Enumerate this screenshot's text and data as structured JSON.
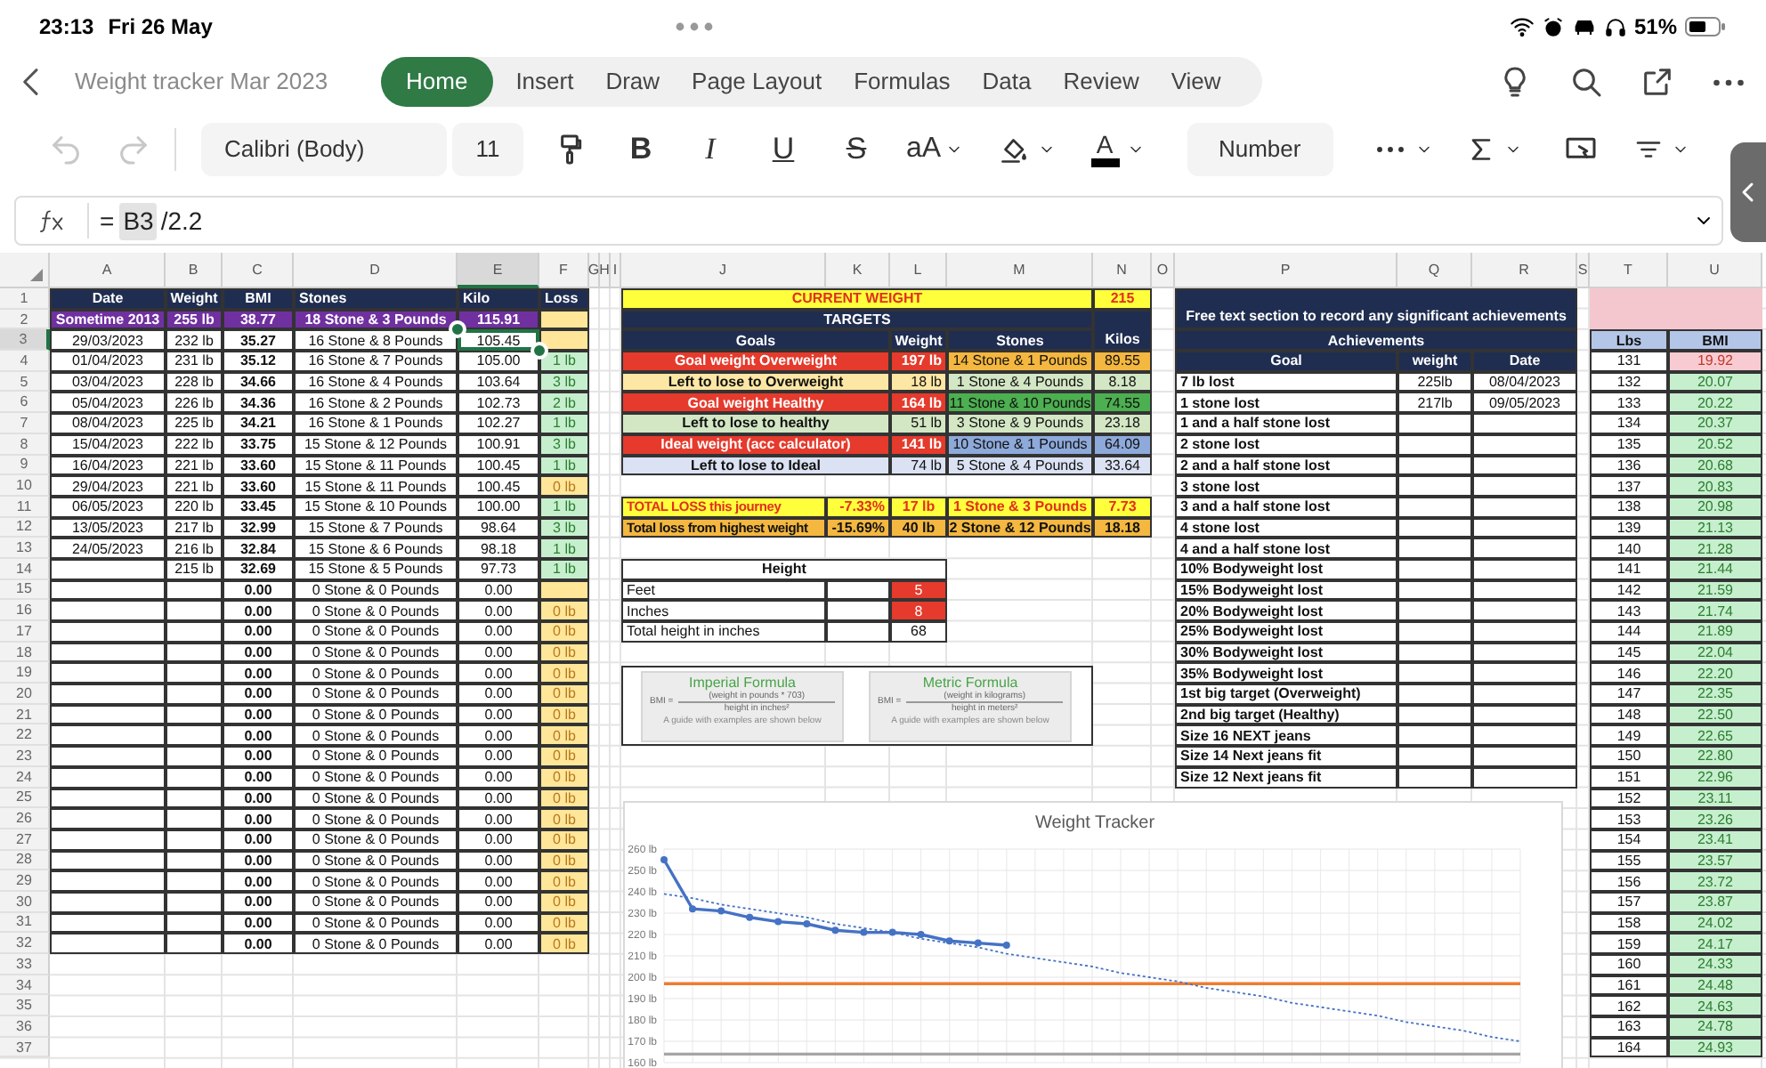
{
  "status_bar": {
    "time": "23:13",
    "date": "Fri 26 May",
    "battery": "51%"
  },
  "document": {
    "title": "Weight tracker Mar 2023"
  },
  "tabs": [
    {
      "label": "Home",
      "selected": true
    },
    {
      "label": "Insert",
      "selected": false
    },
    {
      "label": "Draw",
      "selected": false
    },
    {
      "label": "Page Layout",
      "selected": false
    },
    {
      "label": "Formulas",
      "selected": false
    },
    {
      "label": "Data",
      "selected": false
    },
    {
      "label": "Review",
      "selected": false
    },
    {
      "label": "View",
      "selected": false
    }
  ],
  "toolbar": {
    "font": "Calibri (Body)",
    "font_size": "11",
    "bold": "B",
    "italic": "I",
    "underline": "U",
    "strikethrough": "S",
    "text_size": "aA",
    "font_color": "A",
    "number_format": "Number"
  },
  "formula_bar": {
    "prefix": "=",
    "reference": "B3",
    "rest": "/2.2"
  },
  "columns": [
    {
      "label": "A",
      "selected": false
    },
    {
      "label": "B",
      "selected": false
    },
    {
      "label": "C",
      "selected": false
    },
    {
      "label": "D",
      "selected": false
    },
    {
      "label": "E",
      "selected": true
    },
    {
      "label": "F",
      "selected": false
    },
    {
      "label": "G",
      "selected": false
    },
    {
      "label": "H",
      "selected": false
    },
    {
      "label": "I",
      "selected": false
    },
    {
      "label": "J",
      "selected": false
    },
    {
      "label": "K",
      "selected": false
    },
    {
      "label": "L",
      "selected": false
    },
    {
      "label": "M",
      "selected": false
    },
    {
      "label": "N",
      "selected": false
    },
    {
      "label": "O",
      "selected": false
    },
    {
      "label": "P",
      "selected": false
    },
    {
      "label": "Q",
      "selected": false
    },
    {
      "label": "R",
      "selected": false
    },
    {
      "label": "S",
      "selected": false
    },
    {
      "label": "T",
      "selected": false
    },
    {
      "label": "U",
      "selected": false
    }
  ],
  "rows": [
    {
      "label": "1",
      "selected": false
    },
    {
      "label": "2",
      "selected": false
    },
    {
      "label": "3",
      "selected": true
    },
    {
      "label": "4",
      "selected": false
    },
    {
      "label": "5",
      "selected": false
    },
    {
      "label": "6",
      "selected": false
    },
    {
      "label": "7",
      "selected": false
    },
    {
      "label": "8",
      "selected": false
    },
    {
      "label": "9",
      "selected": false
    },
    {
      "label": "10",
      "selected": false
    },
    {
      "label": "11",
      "selected": false
    },
    {
      "label": "12",
      "selected": false
    },
    {
      "label": "13",
      "selected": false
    },
    {
      "label": "14",
      "selected": false
    },
    {
      "label": "15",
      "selected": false
    },
    {
      "label": "16",
      "selected": false
    },
    {
      "label": "17",
      "selected": false
    },
    {
      "label": "18",
      "selected": false
    },
    {
      "label": "19",
      "selected": false
    },
    {
      "label": "20",
      "selected": false
    },
    {
      "label": "21",
      "selected": false
    },
    {
      "label": "22",
      "selected": false
    },
    {
      "label": "23",
      "selected": false
    },
    {
      "label": "24",
      "selected": false
    },
    {
      "label": "25",
      "selected": false
    },
    {
      "label": "26",
      "selected": false
    },
    {
      "label": "27",
      "selected": false
    },
    {
      "label": "28",
      "selected": false
    },
    {
      "label": "29",
      "selected": false
    },
    {
      "label": "30",
      "selected": false
    },
    {
      "label": "31",
      "selected": false
    },
    {
      "label": "32",
      "selected": false
    },
    {
      "label": "33",
      "selected": false
    },
    {
      "label": "34",
      "selected": false
    },
    {
      "label": "35",
      "selected": false
    },
    {
      "label": "36",
      "selected": false
    },
    {
      "label": "37",
      "selected": false
    }
  ],
  "log": {
    "columns": [
      "Date",
      "Weight",
      "BMI",
      "Stones",
      "Kilo",
      "Loss"
    ],
    "rows": [
      {
        "kind": "start",
        "date": "Sometime 2013",
        "weight": "255 lb",
        "bmi": "38.77",
        "stones": "18 Stone & 3 Pounds",
        "kilo": "115.91",
        "loss": {
          "color": "#ffe699"
        }
      },
      {
        "kind": "entry",
        "date": "29/03/2023",
        "weight": "232 lb",
        "bmi": "35.27",
        "stones": "16 Stone & 8 Pounds",
        "kilo": "105.45",
        "loss": {
          "color": "#ffe699"
        }
      },
      {
        "kind": "entry",
        "date": "01/04/2023",
        "weight": "231 lb",
        "bmi": "35.12",
        "stones": "16 Stone & 7 Pounds",
        "kilo": "105.00",
        "loss": {
          "value": "1 lb",
          "color": "#c6efce"
        }
      },
      {
        "kind": "entry",
        "date": "03/04/2023",
        "weight": "228 lb",
        "bmi": "34.66",
        "stones": "16 Stone & 4 Pounds",
        "kilo": "103.64",
        "loss": {
          "value": "3 lb",
          "color": "#c6efce"
        }
      },
      {
        "kind": "entry",
        "date": "05/04/2023",
        "weight": "226 lb",
        "bmi": "34.36",
        "stones": "16 Stone & 2 Pounds",
        "kilo": "102.73",
        "loss": {
          "value": "2 lb",
          "color": "#c6efce"
        }
      },
      {
        "kind": "entry",
        "date": "08/04/2023",
        "weight": "225 lb",
        "bmi": "34.21",
        "stones": "16 Stone & 1 Pounds",
        "kilo": "102.27",
        "loss": {
          "value": "1 lb",
          "color": "#c6efce"
        }
      },
      {
        "kind": "entry",
        "date": "15/04/2023",
        "weight": "222 lb",
        "bmi": "33.75",
        "stones": "15 Stone & 12 Pounds",
        "kilo": "100.91",
        "loss": {
          "value": "3 lb",
          "color": "#c6efce"
        }
      },
      {
        "kind": "entry",
        "date": "16/04/2023",
        "weight": "221 lb",
        "bmi": "33.60",
        "stones": "15 Stone & 11 Pounds",
        "kilo": "100.45",
        "loss": {
          "value": "1 lb",
          "color": "#c6efce"
        }
      },
      {
        "kind": "entry",
        "date": "29/04/2023",
        "weight": "221 lb",
        "bmi": "33.60",
        "stones": "15 Stone & 11 Pounds",
        "kilo": "100.45",
        "loss": {
          "value": "0 lb",
          "color": "#ffe699"
        }
      },
      {
        "kind": "entry",
        "date": "06/05/2023",
        "weight": "220 lb",
        "bmi": "33.45",
        "stones": "15 Stone & 10 Pounds",
        "kilo": "100.00",
        "loss": {
          "value": "1 lb",
          "color": "#c6efce"
        }
      },
      {
        "kind": "entry",
        "date": "13/05/2023",
        "weight": "217 lb",
        "bmi": "32.99",
        "stones": "15 Stone & 7 Pounds",
        "kilo": "98.64",
        "loss": {
          "value": "3 lb",
          "color": "#c6efce"
        }
      },
      {
        "kind": "entry",
        "date": "24/05/2023",
        "weight": "216 lb",
        "bmi": "32.84",
        "stones": "15 Stone & 6 Pounds",
        "kilo": "98.18",
        "loss": {
          "value": "1 lb",
          "color": "#c6efce"
        }
      },
      {
        "kind": "entry",
        "weight": "215 lb",
        "bmi": "32.69",
        "stones": "15 Stone & 5 Pounds",
        "kilo": "97.73",
        "loss": {
          "value": "1 lb",
          "color": "#c6efce"
        }
      },
      {
        "kind": "entry",
        "bmi": "0.00",
        "stones": "0 Stone & 0 Pounds",
        "kilo": "0.00",
        "loss": {
          "color": "#ffe699"
        }
      },
      {
        "kind": "entry",
        "bmi": "0.00",
        "stones": "0 Stone & 0 Pounds",
        "kilo": "0.00",
        "loss": {
          "value": "0 lb",
          "color": "#ffe699"
        }
      },
      {
        "kind": "entry",
        "bmi": "0.00",
        "stones": "0 Stone & 0 Pounds",
        "kilo": "0.00",
        "loss": {
          "value": "0 lb",
          "color": "#ffe699"
        }
      },
      {
        "kind": "entry",
        "bmi": "0.00",
        "stones": "0 Stone & 0 Pounds",
        "kilo": "0.00",
        "loss": {
          "value": "0 lb",
          "color": "#ffe699"
        }
      },
      {
        "kind": "entry",
        "bmi": "0.00",
        "stones": "0 Stone & 0 Pounds",
        "kilo": "0.00",
        "loss": {
          "value": "0 lb",
          "color": "#ffe699"
        }
      },
      {
        "kind": "entry",
        "bmi": "0.00",
        "stones": "0 Stone & 0 Pounds",
        "kilo": "0.00",
        "loss": {
          "value": "0 lb",
          "color": "#ffe699"
        }
      },
      {
        "kind": "entry",
        "bmi": "0.00",
        "stones": "0 Stone & 0 Pounds",
        "kilo": "0.00",
        "loss": {
          "value": "0 lb",
          "color": "#ffe699"
        }
      },
      {
        "kind": "entry",
        "bmi": "0.00",
        "stones": "0 Stone & 0 Pounds",
        "kilo": "0.00",
        "loss": {
          "value": "0 lb",
          "color": "#ffe699"
        }
      },
      {
        "kind": "entry",
        "bmi": "0.00",
        "stones": "0 Stone & 0 Pounds",
        "kilo": "0.00",
        "loss": {
          "value": "0 lb",
          "color": "#ffe699"
        }
      },
      {
        "kind": "entry",
        "bmi": "0.00",
        "stones": "0 Stone & 0 Pounds",
        "kilo": "0.00",
        "loss": {
          "value": "0 lb",
          "color": "#ffe699"
        }
      },
      {
        "kind": "entry",
        "bmi": "0.00",
        "stones": "0 Stone & 0 Pounds",
        "kilo": "0.00",
        "loss": {
          "value": "0 lb",
          "color": "#ffe699"
        }
      },
      {
        "kind": "entry",
        "bmi": "0.00",
        "stones": "0 Stone & 0 Pounds",
        "kilo": "0.00",
        "loss": {
          "value": "0 lb",
          "color": "#ffe699"
        }
      },
      {
        "kind": "entry",
        "bmi": "0.00",
        "stones": "0 Stone & 0 Pounds",
        "kilo": "0.00",
        "loss": {
          "value": "0 lb",
          "color": "#ffe699"
        }
      },
      {
        "kind": "entry",
        "bmi": "0.00",
        "stones": "0 Stone & 0 Pounds",
        "kilo": "0.00",
        "loss": {
          "value": "0 lb",
          "color": "#ffe699"
        }
      },
      {
        "kind": "entry",
        "bmi": "0.00",
        "stones": "0 Stone & 0 Pounds",
        "kilo": "0.00",
        "loss": {
          "value": "0 lb",
          "color": "#ffe699"
        }
      },
      {
        "kind": "entry",
        "bmi": "0.00",
        "stones": "0 Stone & 0 Pounds",
        "kilo": "0.00",
        "loss": {
          "value": "0 lb",
          "color": "#ffe699"
        }
      },
      {
        "kind": "entry",
        "bmi": "0.00",
        "stones": "0 Stone & 0 Pounds",
        "kilo": "0.00",
        "loss": {
          "value": "0 lb",
          "color": "#ffe699"
        }
      },
      {
        "kind": "entry",
        "bmi": "0.00",
        "stones": "0 Stone & 0 Pounds",
        "kilo": "0.00",
        "loss": {
          "value": "0 lb",
          "color": "#ffe699"
        }
      }
    ]
  },
  "current_weight": {
    "label": "CURRENT WEIGHT",
    "value": "215"
  },
  "targets": {
    "title": "TARGETS",
    "columns": [
      "Goals",
      "Weight",
      "Stones",
      "Kilos"
    ],
    "rows": [
      {
        "kind": "goal",
        "label": "Goal weight Overweight",
        "weight": "197 lb",
        "color": "#e53a2c",
        "conversion": {
          "stones": "14 Stone & 1 Pounds",
          "kilos": "89.55",
          "color": "#f4b73f"
        }
      },
      {
        "kind": "left",
        "label": "Left to lose to Overweight",
        "weight": "18 lb",
        "color": "#fde7a4",
        "conversion": {
          "stones": "1 Stone & 4 Pounds",
          "kilos": "8.18",
          "color": "#d4e7c5"
        }
      },
      {
        "kind": "goal",
        "label": "Goal weight Healthy",
        "weight": "164 lb",
        "color": "#e53a2c",
        "conversion": {
          "stones": "11 Stone & 10 Pounds",
          "kilos": "74.55",
          "color": "#4caf50"
        }
      },
      {
        "kind": "left",
        "label": "Left to lose to healthy",
        "weight": "51 lb",
        "color": "#d4e7c5",
        "conversion": {
          "stones": "3 Stone & 9 Pounds",
          "kilos": "23.18",
          "color": "#d4e7c5"
        }
      },
      {
        "kind": "goal",
        "label": "Ideal weight (acc calculator)",
        "weight": "141 lb",
        "color": "#e53a2c",
        "conversion": {
          "stones": "10 Stone & 1 Pounds",
          "kilos": "64.09",
          "color": "#8eaadb"
        }
      },
      {
        "kind": "left",
        "label": "Left to lose to Ideal",
        "weight": "74 lb",
        "color": "#dbe2f3",
        "conversion": {
          "stones": "5 Stone & 4 Pounds",
          "kilos": "33.64",
          "color": "#dbe2f3"
        }
      }
    ]
  },
  "totals": [
    {
      "kind": "journey",
      "label": "TOTAL LOSS this journey",
      "percent": "-7.33%",
      "weight": "17 lb",
      "stones": "1 Stone & 3 Pounds",
      "kilos": "7.73",
      "color": "#ffff3b"
    },
    {
      "kind": "highest",
      "label": "Total loss from highest weight",
      "percent": "-15.69%",
      "weight": "40 lb",
      "stones": "2 Stone & 12 Pounds",
      "kilos": "18.18",
      "color": "#f4b73f"
    }
  ],
  "height": {
    "title": "Height",
    "rows": [
      {
        "kind": "input",
        "label": "Feet",
        "value": "5"
      },
      {
        "kind": "input",
        "label": "Inches",
        "value": "8"
      },
      {
        "kind": "calc",
        "label": "Total height in inches",
        "value": "68"
      }
    ]
  },
  "formulas": [
    {
      "title": "Imperial Formula",
      "lhs": "BMI =",
      "numerator": "(weight in pounds * 703)",
      "denominator": "height in inches²",
      "note": "A guide with examples are shown below"
    },
    {
      "title": "Metric Formula",
      "lhs": "BMI =",
      "numerator": "(weight in kilograms)",
      "denominator": "height in meters²",
      "note": "A guide with examples are shown below"
    }
  ],
  "achievements": {
    "caption": "Free text section to record any significant achievements",
    "title": "Achievements",
    "columns": [
      "Goal",
      "weight",
      "Date"
    ],
    "rows": [
      {
        "goal": "7 lb lost",
        "weight": "225lb",
        "date": "08/04/2023"
      },
      {
        "goal": "1 stone lost",
        "weight": "217lb",
        "date": "09/05/2023"
      },
      {
        "goal": "1 and a half stone lost"
      },
      {
        "goal": "2 stone lost"
      },
      {
        "goal": "2 and a half stone lost"
      },
      {
        "goal": "3 stone lost"
      },
      {
        "goal": "3 and a half stone lost"
      },
      {
        "goal": "4 stone lost"
      },
      {
        "goal": "4 and a half stone lost"
      },
      {
        "goal": "10% Bodyweight lost"
      },
      {
        "goal": "15% Bodyweight lost"
      },
      {
        "goal": "20% Bodyweight lost"
      },
      {
        "goal": "25% Bodyweight lost"
      },
      {
        "goal": "30% Bodyweight lost"
      },
      {
        "goal": "35% Bodyweight lost"
      },
      {
        "goal": "1st big target (Overweight)"
      },
      {
        "goal": "2nd big target (Healthy)"
      },
      {
        "goal": "Size 16 NEXT jeans"
      },
      {
        "goal": "Size 14 Next jeans fit"
      },
      {
        "goal": "Size 12 Next jeans fit"
      }
    ]
  },
  "bmi_table": {
    "columns": [
      "Lbs",
      "BMI"
    ],
    "rows": [
      {
        "lbs": "131",
        "bmi": "19.92",
        "color": "#f8cbd2"
      },
      {
        "lbs": "132",
        "bmi": "20.07",
        "color": "#c6efce"
      },
      {
        "lbs": "133",
        "bmi": "20.22",
        "color": "#c6efce"
      },
      {
        "lbs": "134",
        "bmi": "20.37",
        "color": "#c6efce"
      },
      {
        "lbs": "135",
        "bmi": "20.52",
        "color": "#c6efce"
      },
      {
        "lbs": "136",
        "bmi": "20.68",
        "color": "#c6efce"
      },
      {
        "lbs": "137",
        "bmi": "20.83",
        "color": "#c6efce"
      },
      {
        "lbs": "138",
        "bmi": "20.98",
        "color": "#c6efce"
      },
      {
        "lbs": "139",
        "bmi": "21.13",
        "color": "#c6efce"
      },
      {
        "lbs": "140",
        "bmi": "21.28",
        "color": "#c6efce"
      },
      {
        "lbs": "141",
        "bmi": "21.44",
        "color": "#c6efce"
      },
      {
        "lbs": "142",
        "bmi": "21.59",
        "color": "#c6efce"
      },
      {
        "lbs": "143",
        "bmi": "21.74",
        "color": "#c6efce"
      },
      {
        "lbs": "144",
        "bmi": "21.89",
        "color": "#c6efce"
      },
      {
        "lbs": "145",
        "bmi": "22.04",
        "color": "#c6efce"
      },
      {
        "lbs": "146",
        "bmi": "22.20",
        "color": "#c6efce"
      },
      {
        "lbs": "147",
        "bmi": "22.35",
        "color": "#c6efce"
      },
      {
        "lbs": "148",
        "bmi": "22.50",
        "color": "#c6efce"
      },
      {
        "lbs": "149",
        "bmi": "22.65",
        "color": "#c6efce"
      },
      {
        "lbs": "150",
        "bmi": "22.80",
        "color": "#c6efce"
      },
      {
        "lbs": "151",
        "bmi": "22.96",
        "color": "#c6efce"
      },
      {
        "lbs": "152",
        "bmi": "23.11",
        "color": "#c6efce"
      },
      {
        "lbs": "153",
        "bmi": "23.26",
        "color": "#c6efce"
      },
      {
        "lbs": "154",
        "bmi": "23.41",
        "color": "#c6efce"
      },
      {
        "lbs": "155",
        "bmi": "23.57",
        "color": "#c6efce"
      },
      {
        "lbs": "156",
        "bmi": "23.72",
        "color": "#c6efce"
      },
      {
        "lbs": "157",
        "bmi": "23.87",
        "color": "#c6efce"
      },
      {
        "lbs": "158",
        "bmi": "24.02",
        "color": "#c6efce"
      },
      {
        "lbs": "159",
        "bmi": "24.17",
        "color": "#c6efce"
      },
      {
        "lbs": "160",
        "bmi": "24.33",
        "color": "#c6efce"
      },
      {
        "lbs": "161",
        "bmi": "24.48",
        "color": "#c6efce"
      },
      {
        "lbs": "162",
        "bmi": "24.63",
        "color": "#c6efce"
      },
      {
        "lbs": "163",
        "bmi": "24.78",
        "color": "#c6efce"
      },
      {
        "lbs": "164",
        "bmi": "24.93",
        "color": "#c6efce"
      }
    ]
  },
  "chart": {
    "chart_data": {
      "type": "line",
      "title": "Weight Tracker",
      "ylim": [
        160,
        260
      ],
      "grid": true,
      "yticks": [
        {
          "value": 160,
          "label": "160 lb"
        },
        {
          "value": 170,
          "label": "170 lb"
        },
        {
          "value": 180,
          "label": "180 lb"
        },
        {
          "value": 190,
          "label": "190 lb"
        },
        {
          "value": 200,
          "label": "200 lb"
        },
        {
          "value": 210,
          "label": "210 lb"
        },
        {
          "value": 220,
          "label": "220 lb"
        },
        {
          "value": 230,
          "label": "230 lb"
        },
        {
          "value": 240,
          "label": "240 lb"
        },
        {
          "value": 250,
          "label": "250 lb"
        },
        {
          "value": 260,
          "label": "260 lb"
        }
      ],
      "series": [
        {
          "color": "#4472c4",
          "marker": "circle",
          "values": [
            255,
            232,
            231,
            228,
            226,
            225,
            222,
            221,
            221,
            220,
            217,
            216,
            215,
            null,
            null,
            null,
            null,
            null,
            null,
            null,
            null,
            null,
            null,
            null,
            null,
            null,
            null,
            null,
            null,
            null,
            null
          ]
        },
        {
          "color": "#4472c4",
          "line_style": "dotted",
          "values": [
            239,
            237,
            234,
            232,
            230,
            228,
            225,
            223,
            221,
            218,
            216,
            214,
            211,
            209,
            207,
            205,
            202,
            200,
            198,
            195,
            193,
            191,
            188,
            186,
            184,
            182,
            179,
            177,
            175,
            172,
            170
          ]
        },
        {
          "color": "#ed7d31",
          "values": [
            197,
            197,
            197,
            197,
            197,
            197,
            197,
            197,
            197,
            197,
            197,
            197,
            197,
            197,
            197,
            197,
            197,
            197,
            197,
            197,
            197,
            197,
            197,
            197,
            197,
            197,
            197,
            197,
            197,
            197,
            197
          ]
        },
        {
          "color": "#a5a5a5",
          "values": [
            164,
            164,
            164,
            164,
            164,
            164,
            164,
            164,
            164,
            164,
            164,
            164,
            164,
            164,
            164,
            164,
            164,
            164,
            164,
            164,
            164,
            164,
            164,
            164,
            164,
            164,
            164,
            164,
            164,
            164,
            164
          ]
        }
      ]
    }
  }
}
